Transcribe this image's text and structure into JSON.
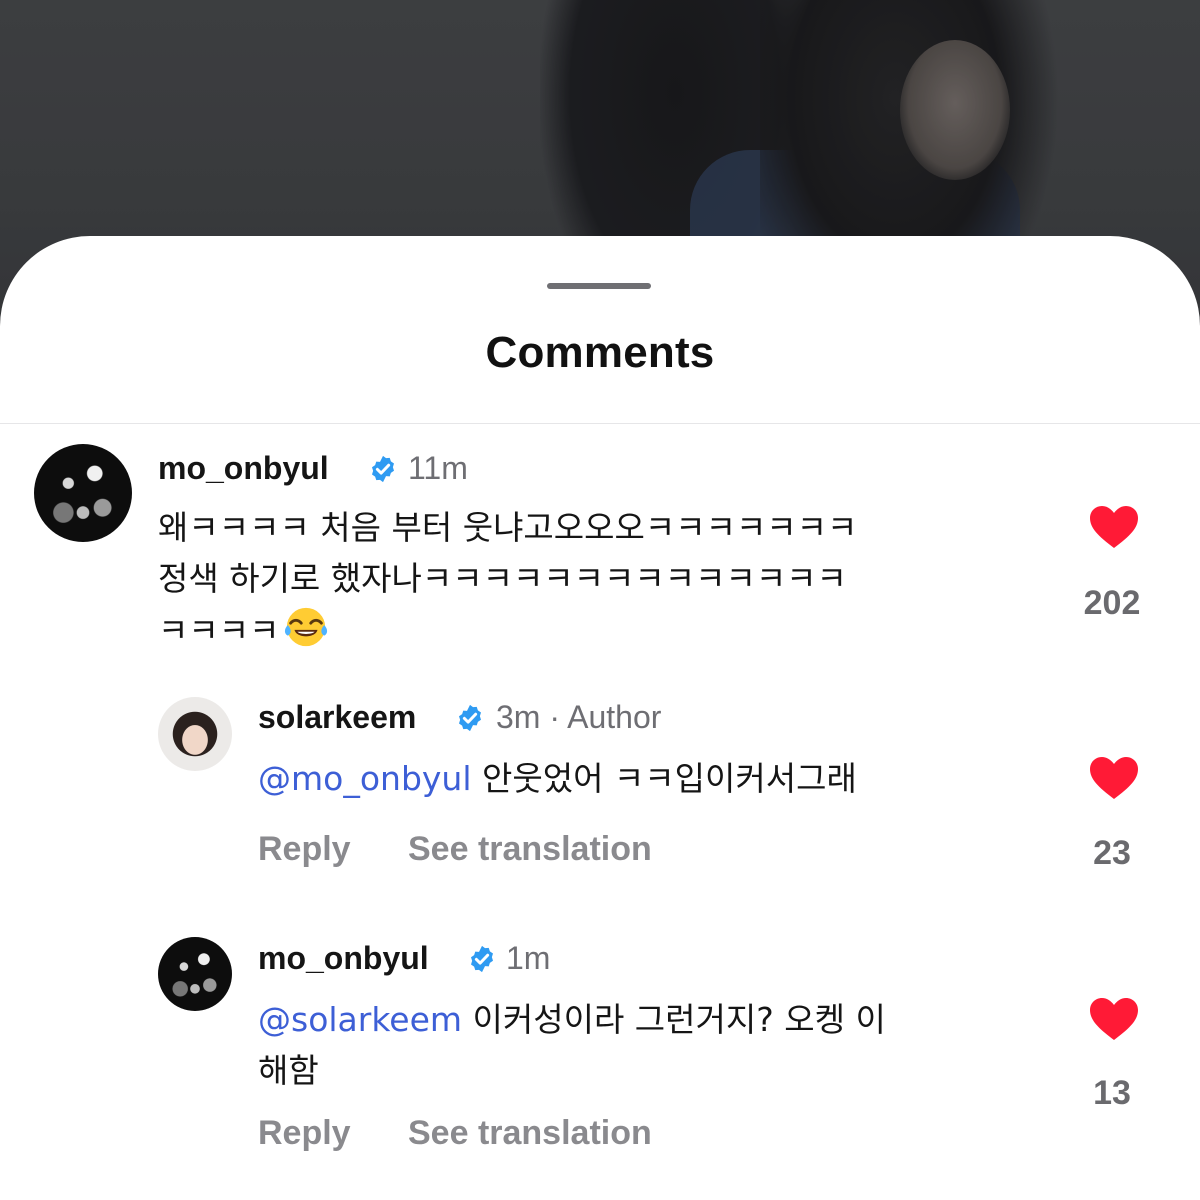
{
  "sheet": {
    "title": "Comments"
  },
  "colors": {
    "accent_mention": "#3d5fd6",
    "like": "#ff1a36",
    "verified": "#2f9bf2",
    "muted": "#8a8a8e"
  },
  "comments": [
    {
      "username": "mo_onbyul",
      "verified": true,
      "time": "11m",
      "text_lines": [
        "왜ㅋㅋㅋㅋ 처음 부터 웃냐고오오오ㅋㅋㅋㅋㅋㅋㅋ",
        "정색 하기로 했자나ㅋㅋㅋㅋㅋㅋㅋㅋㅋㅋㅋㅋㅋㅋ",
        "ㅋㅋㅋㅋ"
      ],
      "emoji": "face-with-tears-of-joy",
      "likes": "202",
      "avatar_icon": "avatar-dark-photo"
    },
    {
      "username": "solarkeem",
      "verified": true,
      "time": "3m",
      "separator": "·",
      "badge": "Author",
      "mention": "@mo_onbyul",
      "text": " 안웃었어 ㅋㅋ입이커서그래",
      "likes": "23",
      "reply_label": "Reply",
      "translate_label": "See translation",
      "avatar_icon": "avatar-portrait"
    },
    {
      "username": "mo_onbyul",
      "verified": true,
      "time": "1m",
      "mention": "@solarkeem",
      "text": " 이커성이라 그런거지? 오켕 이",
      "text_line2": "해함",
      "likes": "13",
      "reply_label": "Reply",
      "translate_label": "See translation",
      "avatar_icon": "avatar-dark-photo"
    }
  ]
}
